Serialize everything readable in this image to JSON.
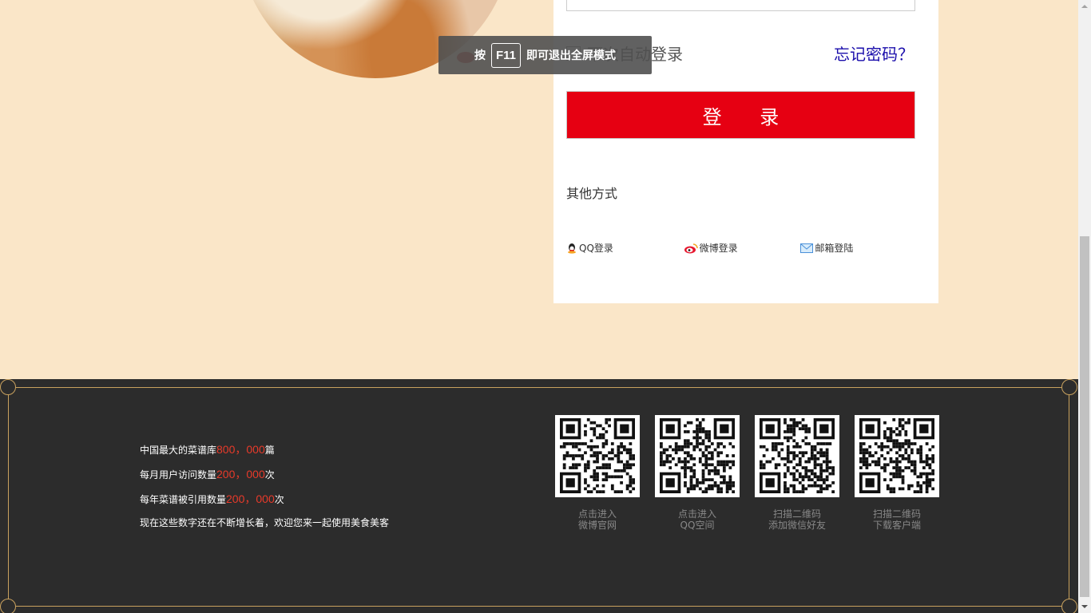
{
  "login": {
    "remember_label": "下次自动登录",
    "forgot_label": "忘记密码？",
    "login_button": "登  录",
    "other_title": "其他方式",
    "other_options": [
      {
        "label": "QQ登录",
        "icon": "qq-icon"
      },
      {
        "label": "微博登录",
        "icon": "weibo-icon"
      },
      {
        "label": "邮箱登陆",
        "icon": "mail-icon"
      }
    ]
  },
  "toast": {
    "prefix": "按",
    "key": "F11",
    "suffix": "即可退出全屏模式"
  },
  "footer": {
    "stats": [
      {
        "before": "中国最大的菜谱库",
        "number": "800，000",
        "after": "篇"
      },
      {
        "before": "每月用户访问数量",
        "number": "200，000",
        "after": "次"
      },
      {
        "before": "每年菜谱被引用数量",
        "number": "200，000",
        "after": "次"
      }
    ],
    "tagline": "现在这些数字还在不断增长着，欢迎您来一起使用美食美客",
    "qr_codes": [
      {
        "line1": "点击进入",
        "line2": "微博官网"
      },
      {
        "line1": "点击进入",
        "line2": "QQ空间"
      },
      {
        "line1": "扫描二维码",
        "line2": "添加微信好友"
      },
      {
        "line1": "扫描二维码",
        "line2": "下载客户端"
      }
    ]
  },
  "colors": {
    "page_bg": "#fae6c8",
    "footer_bg": "#2c2c2c",
    "accent_red": "#e60012",
    "gold_border": "#c8a15e"
  }
}
